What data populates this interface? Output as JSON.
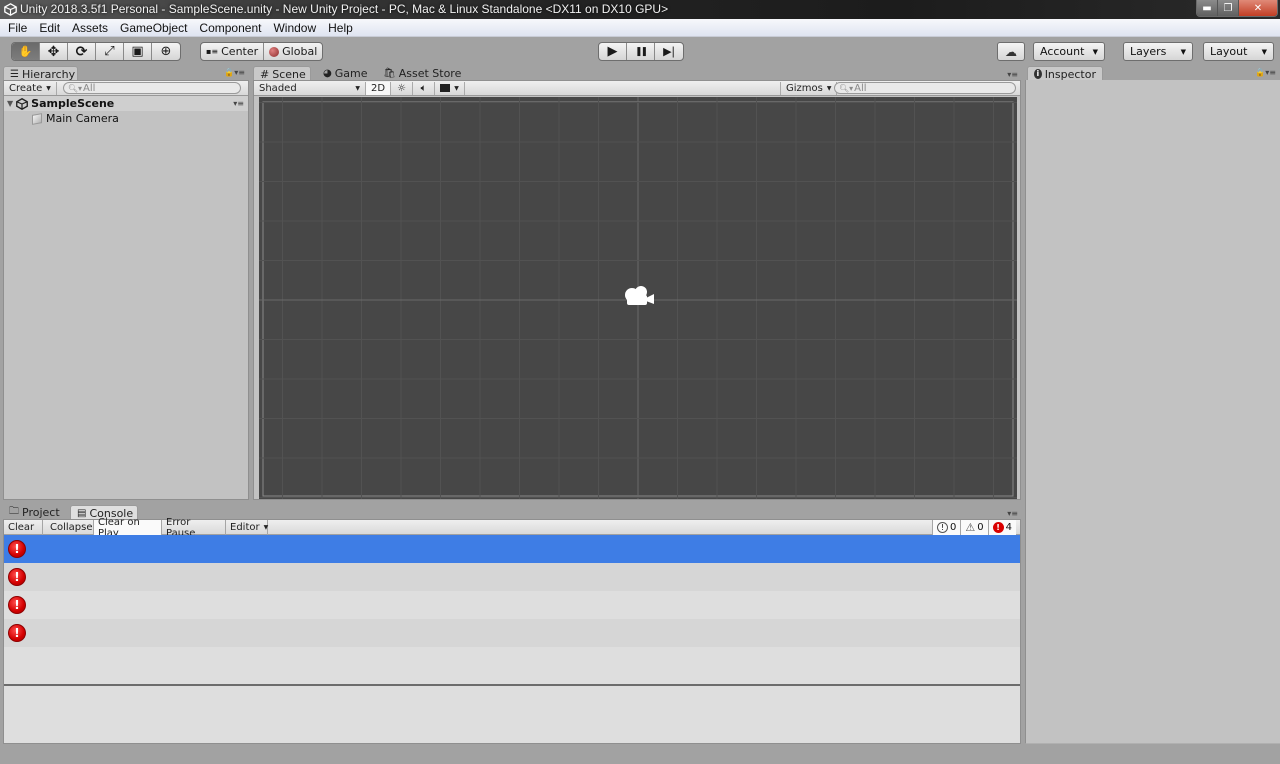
{
  "window": {
    "title": "Unity 2018.3.5f1 Personal - SampleScene.unity - New Unity Project - PC, Mac & Linux Standalone <DX11 on DX10 GPU>",
    "controls": {
      "minimize": "▬",
      "restore": "❐",
      "close": "✕"
    }
  },
  "menu": [
    "File",
    "Edit",
    "Assets",
    "GameObject",
    "Component",
    "Window",
    "Help"
  ],
  "toolbar": {
    "tools": [
      {
        "name": "hand-tool",
        "glyph": "✋",
        "active": true
      },
      {
        "name": "move-tool",
        "glyph": "✥"
      },
      {
        "name": "rotate-tool",
        "glyph": "⟳"
      },
      {
        "name": "scale-tool",
        "glyph": "⤢"
      },
      {
        "name": "rect-tool",
        "glyph": "▣"
      },
      {
        "name": "transform-tool",
        "glyph": "⊕"
      }
    ],
    "pivot_label": "Center",
    "space_label": "Global",
    "play": "▶",
    "pause": "❚❚",
    "step": "▶❘",
    "cloud": "☁",
    "account_label": "Account",
    "layers_label": "Layers",
    "layout_label": "Layout"
  },
  "hierarchy": {
    "tab_label": "Hierarchy",
    "create_label": "Create",
    "search_placeholder": "All",
    "scene_name": "SampleScene",
    "objects": [
      "Main Camera"
    ]
  },
  "scene_view": {
    "tabs": [
      "Scene",
      "Game",
      "Asset Store"
    ],
    "active_tab": "Scene",
    "shading_mode": "Shaded",
    "mode_2d_label": "2D",
    "gizmos_label": "Gizmos",
    "search_placeholder": "All"
  },
  "inspector": {
    "tab_label": "Inspector"
  },
  "console": {
    "tabs": [
      "Project",
      "Console"
    ],
    "active_tab": "Console",
    "buttons": [
      "Clear",
      "Collapse",
      "Clear on Play",
      "Error Pause",
      "Editor"
    ],
    "active_buttons": [
      "Clear on Play"
    ],
    "counts": {
      "info": "0",
      "warning": "0",
      "error": "4"
    },
    "entries": [
      {
        "type": "error",
        "text": "",
        "selected": true
      },
      {
        "type": "error",
        "text": ""
      },
      {
        "type": "error",
        "text": ""
      },
      {
        "type": "error",
        "text": ""
      }
    ]
  }
}
